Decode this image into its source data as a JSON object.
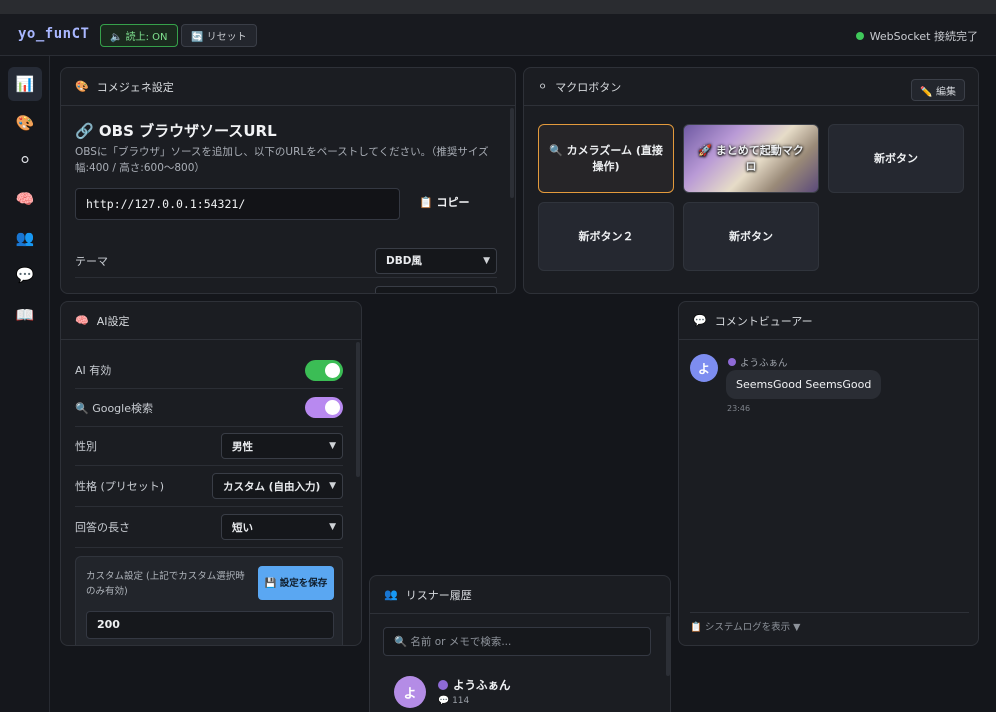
{
  "topbar": {
    "brand": "yo_funCT",
    "read_button": "🔈 読上: ON",
    "reset_button": "🔄 リセット",
    "ws_status": "WebSocket 接続完了"
  },
  "sidebar": {
    "items": [
      {
        "name": "dashboard",
        "icon": "📊"
      },
      {
        "name": "palette",
        "icon": "🎨"
      },
      {
        "name": "macro",
        "icon": "⚪"
      },
      {
        "name": "ai",
        "icon": "🧠"
      },
      {
        "name": "listeners",
        "icon": "👥"
      },
      {
        "name": "comments",
        "icon": "💬"
      },
      {
        "name": "guide",
        "icon": "📖"
      }
    ]
  },
  "comejene": {
    "icon": "🎨",
    "title": "コメジェネ設定",
    "obs_title": "🔗 OBS ブラウザソースURL",
    "obs_desc": "OBSに「ブラウザ」ソースを追加し、以下のURLをペーストしてください。（推奨サイズ 幅:400 / 高さ:600〜800）",
    "url": "http://127.0.0.1:54321/",
    "copy_label": "📋 コピー",
    "theme_label": "テーマ",
    "theme_value": "DBD風"
  },
  "macro": {
    "icon": "⚪",
    "title": "マクロボタン",
    "edit_label": "✏️ 編集",
    "buttons": [
      {
        "label": "🔍 カメラズーム (直接操作)"
      },
      {
        "label": "🚀 まとめて起動マクロ"
      },
      {
        "label": "新ボタン"
      },
      {
        "label": "新ボタン２"
      },
      {
        "label": "新ボタン"
      }
    ]
  },
  "ai": {
    "icon": "🧠",
    "title": "AI設定",
    "ai_enabled_label": "AI 有効",
    "google_label": "🔍 Google検索",
    "gender_label": "性別",
    "gender_value": "男性",
    "personality_label": "性格 (プリセット)",
    "personality_value": "カスタム (自由入力)",
    "length_label": "回答の長さ",
    "length_value": "短い",
    "custom_label": "カスタム設定 (上記でカスタム選択時のみ有効)",
    "save_label": "💾 設定を保存",
    "custom_value": "200"
  },
  "listeners": {
    "icon": "👥",
    "title": "リスナー履歴",
    "search_placeholder": "🔍 名前 or メモで検索...",
    "items": [
      {
        "avatar": "よ",
        "name": "ようふぁん",
        "count": "💬 114"
      }
    ]
  },
  "comments": {
    "icon": "💬",
    "title": "コメントビューアー",
    "items": [
      {
        "avatar": "よ",
        "name": "ようふぁん",
        "text": "SeemsGood SeemsGood",
        "time": "23:46"
      }
    ],
    "footer": "📋 システムログを表示 ▼"
  },
  "colors": {
    "accent_blue": "#a9b7ff",
    "ok_green": "#3bbd55",
    "toggle_purple": "#b889f0",
    "save_blue": "#5aa7f2",
    "selected_orange": "#e39a3c"
  }
}
